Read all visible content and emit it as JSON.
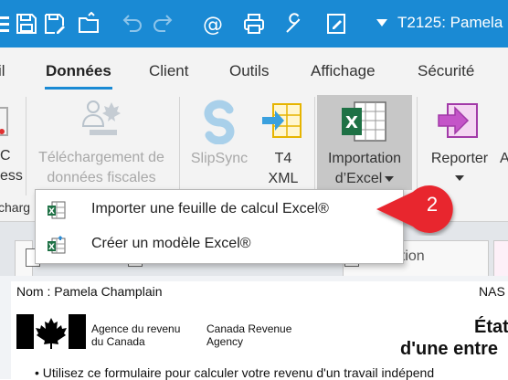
{
  "titlebar": {
    "title": "T2125: Pamela",
    "icons": [
      "menu-icon",
      "save-icon",
      "open-folder-icon",
      "undo-icon",
      "redo-icon",
      "email-icon",
      "print-icon",
      "wrench-icon",
      "edit-form-icon",
      "dropdown-icon"
    ]
  },
  "tabs": {
    "partial": "il",
    "donnees": "Données",
    "client": "Client",
    "outils": "Outils",
    "affichage": "Affichage",
    "securite": "Sécurité"
  },
  "ribbon": {
    "left_partial_1": "C",
    "left_partial_2": "ess",
    "telechargement_1": "Téléchargement de",
    "telechargement_2": "données fiscales",
    "slipsync": "SlipSync",
    "t4xml_1": "T4",
    "t4xml_2": "XML",
    "importation_1": "Importation",
    "importation_2": "d’Excel",
    "reporter": "Reporter",
    "right_partial": "A",
    "group_partial": "charg"
  },
  "menu": {
    "items": [
      {
        "label": "Importer une feuille de calcul Excel®",
        "icon": "excel-import-icon"
      },
      {
        "label": "Créer un modèle Excel®",
        "icon": "excel-template-icon"
      }
    ]
  },
  "callout": {
    "number": "2",
    "color": "#e8262f"
  },
  "doc_tabs": {
    "visible_partial": "ation"
  },
  "form": {
    "nom": "Nom : Pamela Champlain",
    "nas": "NAS",
    "agency_fr_1": "Agence du revenu",
    "agency_fr_2": "du Canada",
    "agency_en_1": "Canada Revenue",
    "agency_en_2": "Agency",
    "title_1": "État",
    "title_2": "d'une entre",
    "bullet": "• Utilisez ce formulaire pour calculer votre revenu d'un travail indépend"
  },
  "colors": {
    "titlebar": "#1a8ad4",
    "accent": "#1a8ad4",
    "excel_green": "#1e7145",
    "reporter_purple": "#a23aa8"
  }
}
